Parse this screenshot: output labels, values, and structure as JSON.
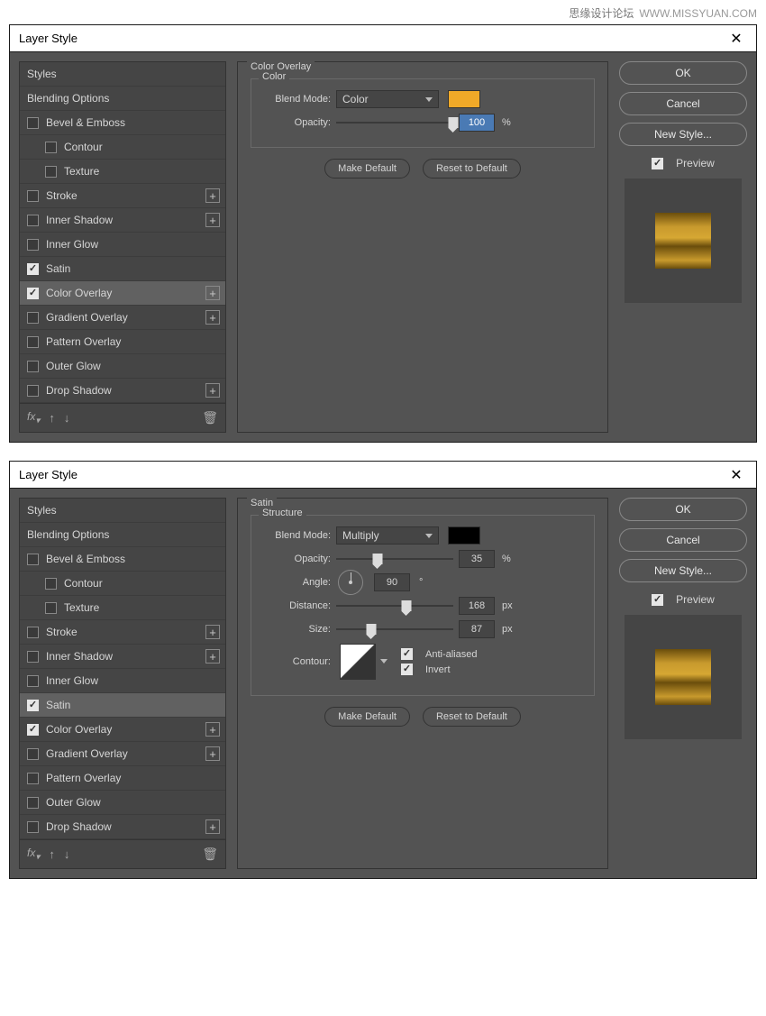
{
  "watermark": {
    "cn": "思缘设计论坛",
    "url": "WWW.MISSYUAN.COM"
  },
  "dialog_title": "Layer Style",
  "styles_header": "Styles",
  "blending_options": "Blending Options",
  "style_items": [
    {
      "key": "bevel",
      "label": "Bevel & Emboss",
      "checked": false,
      "plus": false
    },
    {
      "key": "contour",
      "label": "Contour",
      "checked": false,
      "plus": false,
      "sub": true
    },
    {
      "key": "texture",
      "label": "Texture",
      "checked": false,
      "plus": false,
      "sub": true
    },
    {
      "key": "stroke",
      "label": "Stroke",
      "checked": false,
      "plus": true
    },
    {
      "key": "innershadow",
      "label": "Inner Shadow",
      "checked": false,
      "plus": true
    },
    {
      "key": "innerglow",
      "label": "Inner Glow",
      "checked": false,
      "plus": false
    },
    {
      "key": "satin",
      "label": "Satin",
      "checked": true,
      "plus": false
    },
    {
      "key": "coloroverlay",
      "label": "Color Overlay",
      "checked": true,
      "plus": true
    },
    {
      "key": "gradientoverlay",
      "label": "Gradient Overlay",
      "checked": false,
      "plus": true
    },
    {
      "key": "patternoverlay",
      "label": "Pattern Overlay",
      "checked": false,
      "plus": false
    },
    {
      "key": "outerglow",
      "label": "Outer Glow",
      "checked": false,
      "plus": false
    },
    {
      "key": "dropshadow",
      "label": "Drop Shadow",
      "checked": false,
      "plus": true
    }
  ],
  "fx_label": "fx",
  "right": {
    "ok": "OK",
    "cancel": "Cancel",
    "newstyle": "New Style...",
    "preview": "Preview"
  },
  "d1": {
    "selected_style": "coloroverlay",
    "section_title": "Color Overlay",
    "group_title": "Color",
    "blend_mode_label": "Blend Mode:",
    "blend_mode_value": "Color",
    "swatch_color": "#f0a928",
    "opacity_label": "Opacity:",
    "opacity_value": "100",
    "opacity_unit": "%",
    "make_default": "Make Default",
    "reset_default": "Reset to Default"
  },
  "d2": {
    "selected_style": "satin",
    "section_title": "Satin",
    "group_title": "Structure",
    "blend_mode_label": "Blend Mode:",
    "blend_mode_value": "Multiply",
    "swatch_color": "#000000",
    "opacity_label": "Opacity:",
    "opacity_value": "35",
    "opacity_unit": "%",
    "angle_label": "Angle:",
    "angle_value": "90",
    "angle_unit": "°",
    "distance_label": "Distance:",
    "distance_value": "168",
    "distance_unit": "px",
    "size_label": "Size:",
    "size_value": "87",
    "size_unit": "px",
    "contour_label": "Contour:",
    "antialiased_label": "Anti-aliased",
    "antialiased_checked": true,
    "invert_label": "Invert",
    "invert_checked": true,
    "make_default": "Make Default",
    "reset_default": "Reset to Default"
  }
}
